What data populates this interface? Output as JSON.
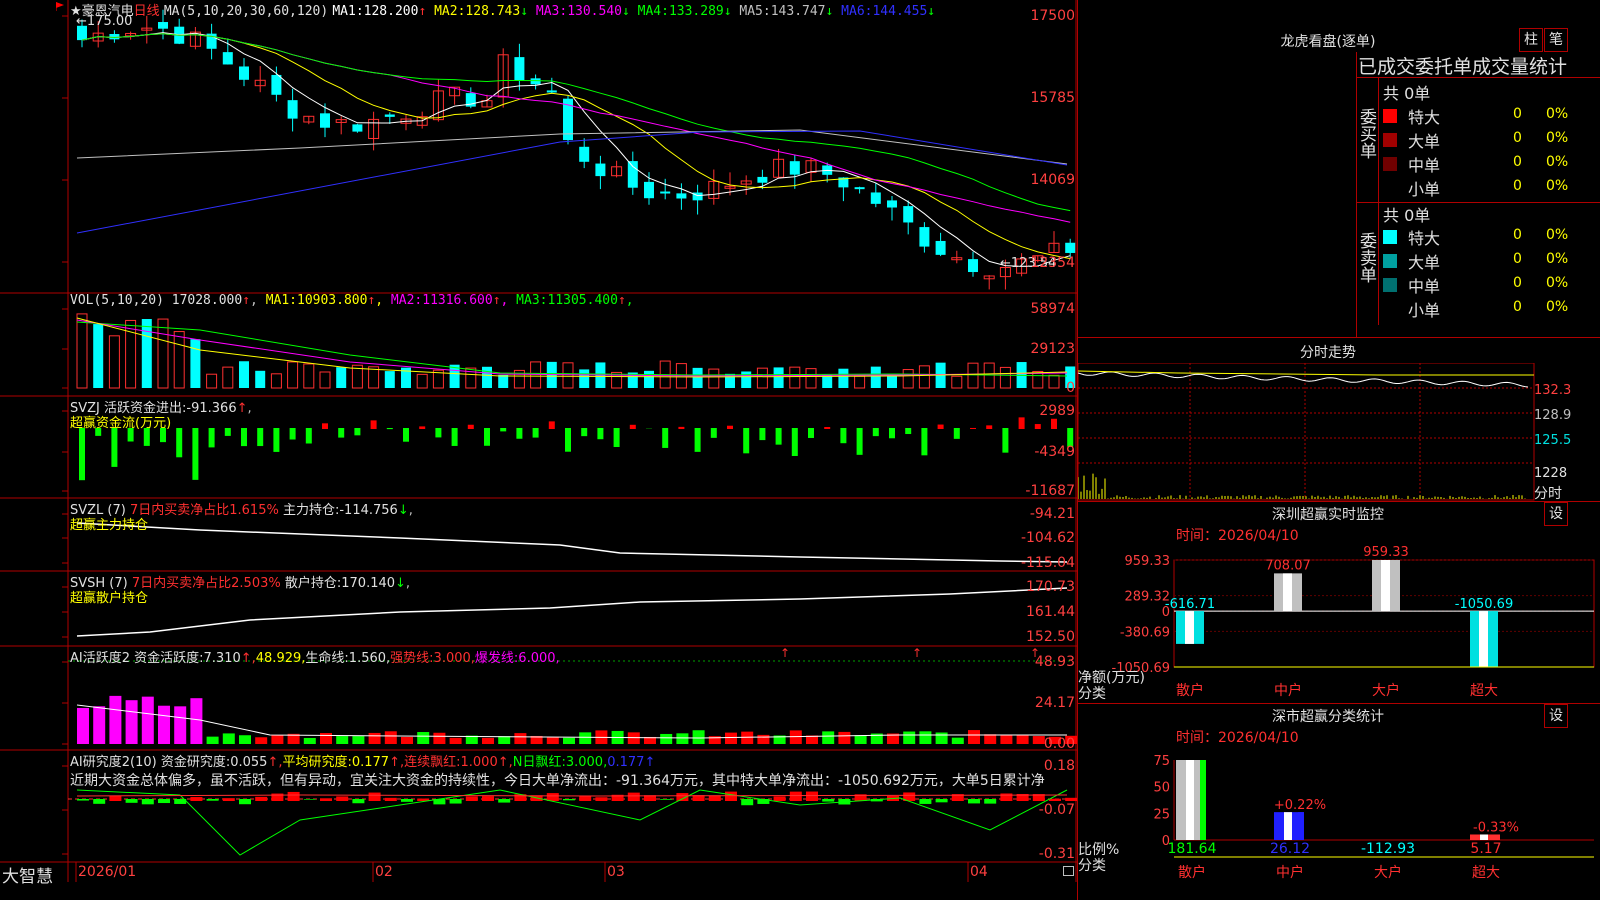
{
  "main_chart": {
    "flag_icon": "red-flag-icon",
    "star": "★",
    "stock_name": "豪恩汽电",
    "period": "日线",
    "ma_label": "MA(5,10,20,30,60,120)",
    "ma": [
      {
        "label": "MA1:",
        "value": "128.200",
        "arrow": "↑",
        "color": "#ffffff"
      },
      {
        "label": "MA2:",
        "value": "128.743",
        "arrow": "↓",
        "color": "#ffff00"
      },
      {
        "label": "MA3:",
        "value": "130.540",
        "arrow": "↓",
        "color": "#ff00ff"
      },
      {
        "label": "MA4:",
        "value": "133.289",
        "arrow": "↓",
        "color": "#00ff00"
      },
      {
        "label": "MA5:",
        "value": "143.747",
        "arrow": "↓",
        "color": "#c0c0c0"
      },
      {
        "label": "MA6:",
        "value": "144.455",
        "arrow": "↓",
        "color": "#3030ff"
      }
    ],
    "high_mark": "175.00",
    "low_mark": "123.54",
    "y_ticks": [
      "17500",
      "15785",
      "14069",
      "12354"
    ]
  },
  "vol_panel": {
    "label": "VOL(5,10,20)",
    "value": "17028.000",
    "ma": [
      {
        "label": "MA1:",
        "value": "10903.800",
        "arrow": "↑",
        "color": "#ffff00"
      },
      {
        "label": "MA2:",
        "value": "11316.600",
        "arrow": "↑",
        "color": "#ff00ff"
      },
      {
        "label": "MA3:",
        "value": "11305.400",
        "arrow": "↑",
        "color": "#00ff00"
      }
    ],
    "y_ticks": [
      "58974",
      "29123",
      "0"
    ]
  },
  "svzj_panel": {
    "label": "SVZJ",
    "desc": "活跃资金进出:",
    "value": "-91.366",
    "arrow": "↑",
    "title": "超赢资金流(万元)",
    "y_ticks": [
      "2989",
      "-4349",
      "-11687"
    ]
  },
  "svzl_panel": {
    "label": "SVZL (7)",
    "net_text": "7日内买卖净占比1.615%",
    "hold_label": "主力持仓:",
    "hold_value": "-114.756",
    "arrow": "↓",
    "title": "超赢主力持仓",
    "y_ticks": [
      "-94.21",
      "-104.62",
      "-115.04"
    ]
  },
  "svsh_panel": {
    "label": "SVSH (7)",
    "net_text": "7日内买卖净占比2.503%",
    "hold_label": "散户持仓:",
    "hold_value": "170.140",
    "arrow": "↓",
    "title": "超赢散户持仓",
    "y_ticks": [
      "170.73",
      "161.44",
      "152.50"
    ]
  },
  "ai_active_panel": {
    "label": "AI活跃度2",
    "items": [
      {
        "text": "资金活跃度:",
        "color": "#e0e0e0"
      },
      {
        "text": "7.310",
        "color": "#e0e0e0"
      },
      {
        "text": "↑,",
        "color": "#ff3030"
      },
      {
        "text": "48.929,",
        "color": "#ffff00"
      },
      {
        "text": "生命线:",
        "color": "#e0e0e0"
      },
      {
        "text": "1.560,",
        "color": "#e0e0e0"
      },
      {
        "text": "强势线:",
        "color": "#ff3030"
      },
      {
        "text": "3.000,",
        "color": "#ff3030"
      },
      {
        "text": "爆发线:",
        "color": "#ff00ff"
      },
      {
        "text": "6.000,",
        "color": "#ff00ff"
      }
    ],
    "y_ticks": [
      "48.93",
      "24.17",
      "0.00"
    ]
  },
  "ai_research_panel": {
    "label": "AI研究度2(10)",
    "items": [
      {
        "text": "资金研究度:",
        "color": "#e0e0e0"
      },
      {
        "text": "0.055",
        "color": "#e0e0e0"
      },
      {
        "text": "↑,",
        "color": "#ff3030"
      },
      {
        "text": "平均研究度:",
        "color": "#ffff00"
      },
      {
        "text": "0.177",
        "color": "#ffff00"
      },
      {
        "text": "↑,",
        "color": "#ff3030"
      },
      {
        "text": "连续飘红:",
        "color": "#ff3030"
      },
      {
        "text": "1.000",
        "color": "#ff3030"
      },
      {
        "text": "↑,",
        "color": "#ff3030"
      },
      {
        "text": "N日飘红:",
        "color": "#00ff00"
      },
      {
        "text": "3.000",
        "color": "#00ff00"
      },
      {
        "text": ",",
        "color": "#00ff00"
      },
      {
        "text": "0.177",
        "color": "#3030ff"
      },
      {
        "text": "↑",
        "color": "#3030ff"
      }
    ],
    "comment": "近期大资金总体偏多，虽不活跃，但有异动，宜关注大资金的持续性，今日大单净流出：-91.364万元，其中特大单净流出：-1050.692万元，大单5日累计净",
    "y_ticks": [
      "0.18",
      "-0.07",
      "-0.31"
    ]
  },
  "x_axis": {
    "brand": "大智慧",
    "labels": [
      "2026/01",
      "02",
      "03",
      "04"
    ]
  },
  "dragon_panel": {
    "title": "龙虎看盘(逐单)",
    "btn_bar": "柱",
    "btn_stroke": "笔",
    "header": "已成交委托单成交量统计",
    "buy": {
      "side_label": "委买单",
      "total": "共 0单",
      "rows": [
        {
          "label": "特大",
          "count": "0",
          "pct": "0%",
          "color": "#ff0000"
        },
        {
          "label": "大单",
          "count": "0",
          "pct": "0%",
          "color": "#a00000"
        },
        {
          "label": "中单",
          "count": "0",
          "pct": "0%",
          "color": "#700000"
        },
        {
          "label": "小单",
          "count": "0",
          "pct": "0%",
          "color": ""
        }
      ]
    },
    "sell": {
      "side_label": "委卖单",
      "total": "共 0单",
      "rows": [
        {
          "label": "特大",
          "count": "0",
          "pct": "0%",
          "color": "#00ffff"
        },
        {
          "label": "大单",
          "count": "0",
          "pct": "0%",
          "color": "#00a0a0"
        },
        {
          "label": "中单",
          "count": "0",
          "pct": "0%",
          "color": "#007070"
        },
        {
          "label": "小单",
          "count": "0",
          "pct": "0%",
          "color": ""
        }
      ]
    }
  },
  "intraday_panel": {
    "title": "分时走势",
    "price_ticks": [
      "132.3",
      "128.9",
      "125.5"
    ],
    "vol_tick": "1228",
    "corner_label": "分时"
  },
  "sz_monitor": {
    "title": "深圳超赢实时监控",
    "settings_btn": "设",
    "time_label": "时间：2026/04/10",
    "y_ticks": [
      "959.33",
      "289.32",
      "0",
      "-380.69",
      "-1050.69"
    ],
    "y_unit": "净额(万元)",
    "x_unit": "分类",
    "chart_data": {
      "type": "bar",
      "categories": [
        "散户",
        "中户",
        "大户",
        "超大"
      ],
      "values": [
        -616.71,
        708.07,
        959.33,
        -1050.69
      ],
      "value_labels": [
        "-616.71",
        "708.07",
        "959.33",
        "-1050.69"
      ],
      "ylabel": "净额(万元)",
      "xlabel": "分类",
      "ylim": [
        -1050.69,
        959.33
      ]
    }
  },
  "sz_class_stats": {
    "title": "深市超赢分类统计",
    "settings_btn": "设",
    "time_label": "时间：2026/04/10",
    "y_ticks": [
      "75",
      "50",
      "25",
      "0"
    ],
    "y_unit": "比例%",
    "x_unit": "分类",
    "chart_data": {
      "type": "bar",
      "categories": [
        "散户",
        "中户",
        "大户",
        "超大"
      ],
      "values": [
        181.64,
        26.12,
        -112.93,
        5.17
      ],
      "value_labels": [
        "181.64",
        "26.12",
        "-112.93",
        "5.17"
      ],
      "change_labels": [
        "",
        "+0.22%",
        "",
        "-0.33%"
      ],
      "ylabel": "比例%",
      "xlabel": "分类",
      "ylim": [
        0,
        75
      ]
    }
  }
}
